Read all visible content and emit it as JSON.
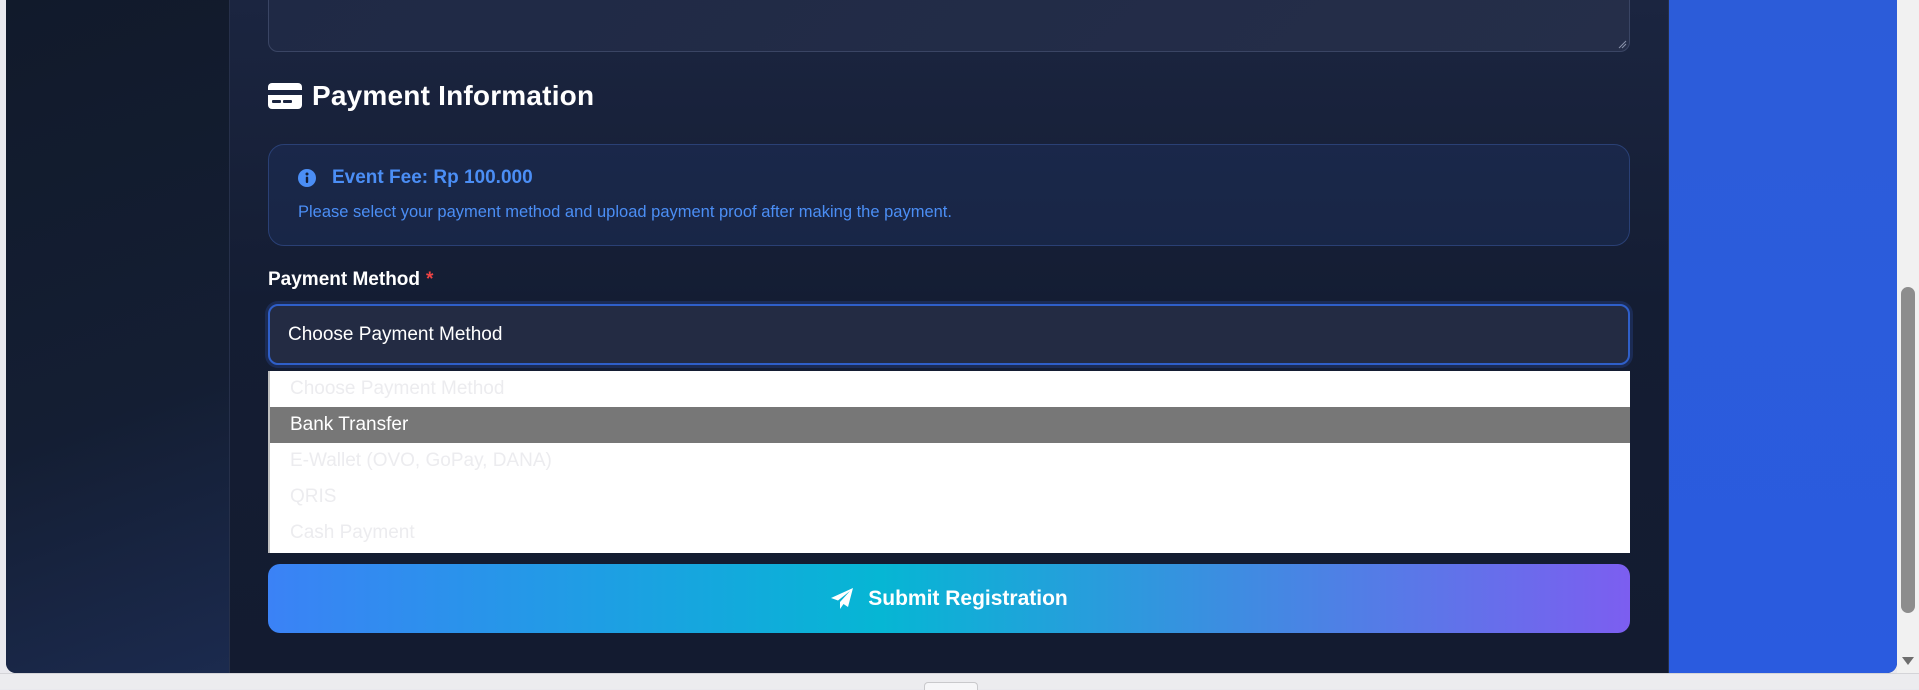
{
  "payment_section": {
    "title": "Payment Information",
    "icon": "credit-card-icon"
  },
  "info_box": {
    "icon": "info-circle-icon",
    "fee_text": "Event Fee: Rp 100.000",
    "description": "Please select your payment method and upload payment proof after making the payment."
  },
  "payment_method": {
    "label": "Payment Method",
    "required_mark": "*",
    "selected_value": "Choose Payment Method",
    "options": [
      "Choose Payment Method",
      "Bank Transfer",
      "E-Wallet (OVO, GoPay, DANA)",
      "QRIS",
      "Cash Payment"
    ],
    "highlighted_option": "Bank Transfer"
  },
  "submit": {
    "label": "Submit Registration",
    "icon": "paper-plane-icon"
  },
  "colors": {
    "accent_blue": "#4b8ef5",
    "required_red": "#ef4444",
    "button_gradient_start": "#3b82f6",
    "button_gradient_mid": "#06b6d4",
    "button_gradient_end": "#7c5ef0",
    "page_right_blue": "#2a5bdf"
  }
}
